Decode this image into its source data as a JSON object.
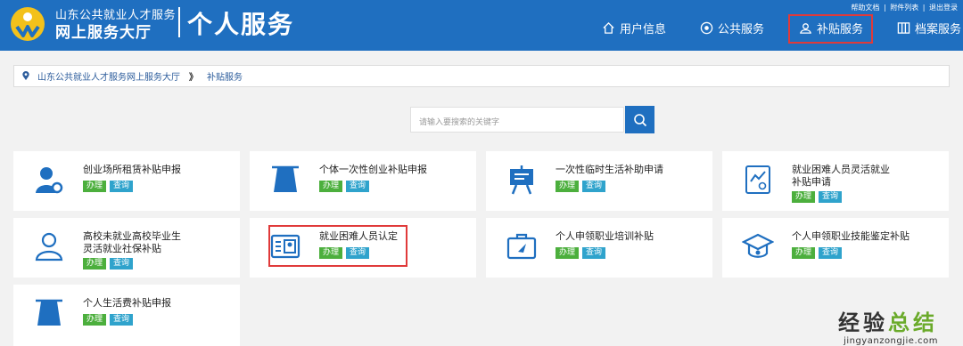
{
  "header": {
    "org_line1": "山东公共就业人才服务",
    "org_line2": "网上服务大厅",
    "title": "个人服务",
    "top_links": [
      "帮助文档",
      "附件列表",
      "退出登录"
    ],
    "nav": [
      {
        "label": "用户信息",
        "icon": "home-icon"
      },
      {
        "label": "公共服务",
        "icon": "eye-icon"
      },
      {
        "label": "补贴服务",
        "icon": "user-badge-icon",
        "active": true
      },
      {
        "label": "档案服务",
        "icon": "archive-icon"
      }
    ],
    "colors": {
      "bar": "#1f6fc0",
      "highlight": "#e03a3a"
    }
  },
  "breadcrumb": {
    "items": [
      "山东公共就业人才服务网上服务大厅",
      "补贴服务"
    ],
    "separator": "》"
  },
  "search": {
    "placeholder": "请输入要搜索的关键字"
  },
  "buttons": {
    "do": "办理",
    "query": "查询"
  },
  "cards": [
    {
      "title": "创业场所租赁补贴申报",
      "icon": "person-settings-icon"
    },
    {
      "title": "个体一次性创业补贴申报",
      "icon": "cone-icon"
    },
    {
      "title": "一次性临时生活补助申请",
      "icon": "easel-icon"
    },
    {
      "title": "就业困难人员灵活就业补贴申请",
      "icon": "chart-doc-icon"
    },
    {
      "title": "高校未就业高校毕业生灵活就业社保补贴",
      "icon": "person-outline-icon"
    },
    {
      "title": "就业困难人员认定",
      "icon": "id-card-icon",
      "highlighted": true
    },
    {
      "title": "个人申领职业培训补贴",
      "icon": "briefcase-icon"
    },
    {
      "title": "个人申领职业技能鉴定补贴",
      "icon": "graduation-cap-icon"
    },
    {
      "title": "个人生活费补贴申报",
      "icon": "cone-icon"
    }
  ],
  "watermark": {
    "main_1": "经验",
    "main_2": "总结",
    "sub": "jingyanzongjie.com"
  }
}
